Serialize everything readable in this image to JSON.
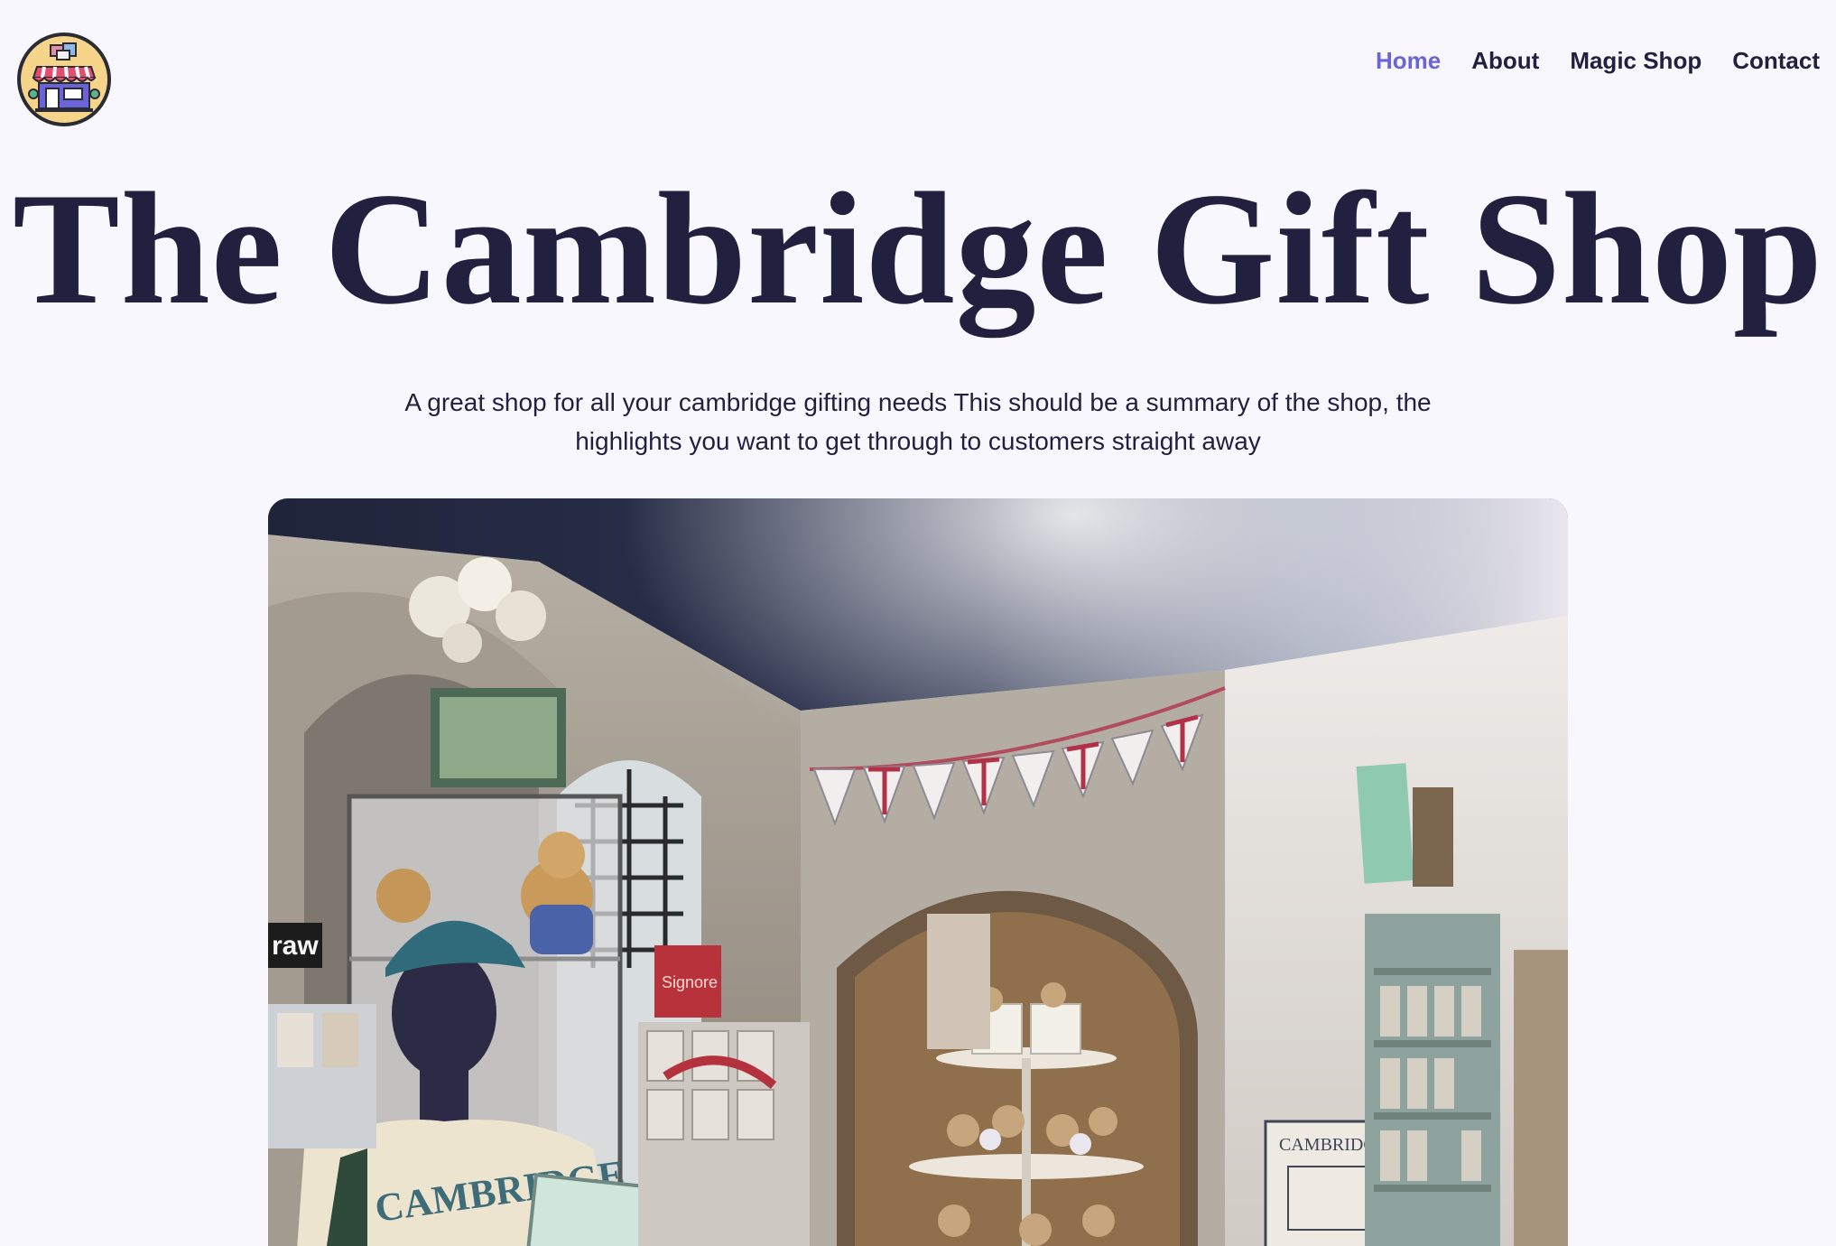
{
  "header": {
    "logo_icon": "gift-shop-storefront-icon",
    "nav": [
      {
        "label": "Home",
        "active": true
      },
      {
        "label": "About",
        "active": false
      },
      {
        "label": "Magic Shop",
        "active": false
      },
      {
        "label": "Contact",
        "active": false
      }
    ]
  },
  "hero": {
    "title": "The Cambridge Gift Shop",
    "subtitle": "A great shop for all your cambridge gifting needs This should be a summary of the shop, the highlights you want to get through to customers straight away"
  },
  "photo": {
    "subject": "shop-interior-photo",
    "visible_text": {
      "sweatshirt": "CAMBRIDGE",
      "cap": "CAMBRIDGE",
      "apron": "CAMBRIDGE",
      "sign": "Signore",
      "card": "raw",
      "board": "Official Cambridge"
    }
  },
  "colors": {
    "background": "#f8f7fd",
    "text": "#221f3f",
    "accent": "#6b64d8",
    "logo_bg": "#f6d58a"
  }
}
